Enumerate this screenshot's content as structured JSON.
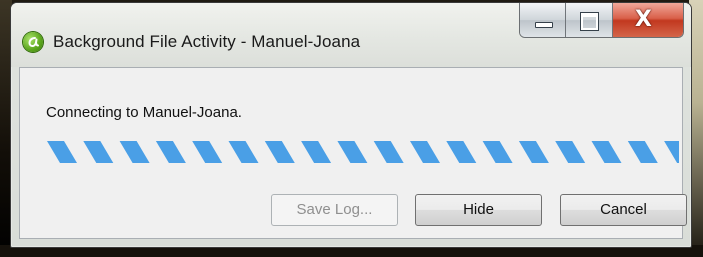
{
  "window": {
    "title": "Background File Activity - Manuel-Joana",
    "icon": "app-logo-icon",
    "controls": {
      "minimize_icon": "minimize-icon",
      "maximize_icon": "maximize-icon",
      "close_icon": "close-icon",
      "close_glyph": "X"
    }
  },
  "status": {
    "message": "Connecting to Manuel-Joana."
  },
  "progress": {
    "mode": "indeterminate",
    "stripe_color": "#4a9fe6"
  },
  "buttons": {
    "save_log": "Save Log...",
    "hide": "Hide",
    "cancel": "Cancel"
  }
}
